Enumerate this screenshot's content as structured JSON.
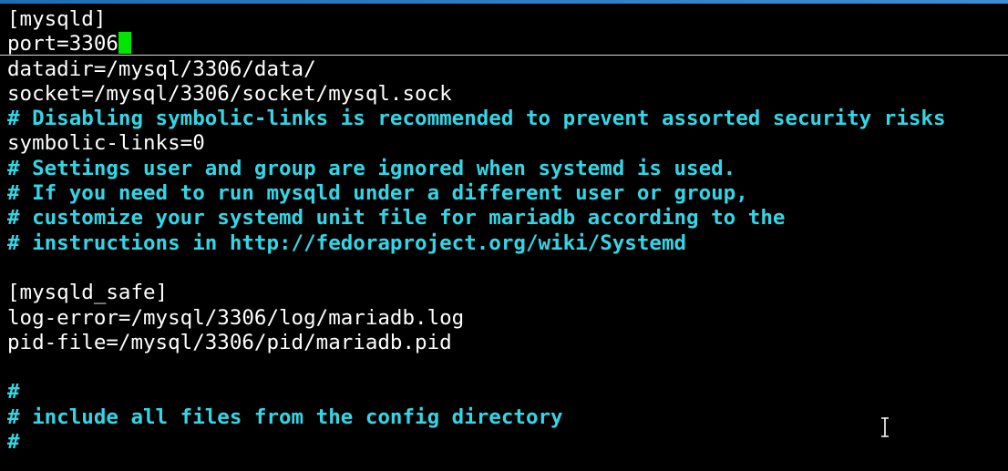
{
  "terminal": {
    "lines": [
      {
        "text": "[mysqld]",
        "kind": "plain"
      },
      {
        "text": "port=3306",
        "kind": "plain"
      },
      {
        "text": "datadir=/mysql/3306/data/",
        "kind": "plain"
      },
      {
        "text": "socket=/mysql/3306/socket/mysql.sock",
        "kind": "plain"
      },
      {
        "text": "# Disabling symbolic-links is recommended to prevent assorted security risks",
        "kind": "comment"
      },
      {
        "text": "symbolic-links=0",
        "kind": "plain"
      },
      {
        "text": "# Settings user and group are ignored when systemd is used.",
        "kind": "comment"
      },
      {
        "text": "# If you need to run mysqld under a different user or group,",
        "kind": "comment"
      },
      {
        "text": "# customize your systemd unit file for mariadb according to the",
        "kind": "comment"
      },
      {
        "text": "# instructions in http://fedoraproject.org/wiki/Systemd",
        "kind": "comment"
      },
      {
        "text": "",
        "kind": "plain"
      },
      {
        "text": "[mysqld_safe]",
        "kind": "plain"
      },
      {
        "text": "log-error=/mysql/3306/log/mariadb.log",
        "kind": "plain"
      },
      {
        "text": "pid-file=/mysql/3306/pid/mariadb.pid",
        "kind": "plain"
      },
      {
        "text": "",
        "kind": "plain"
      },
      {
        "text": "#",
        "kind": "comment"
      },
      {
        "text": "# include all files from the config directory",
        "kind": "comment"
      },
      {
        "text": "#",
        "kind": "comment"
      }
    ]
  },
  "colors": {
    "background": "#000000",
    "text": "#ffffff",
    "comment": "#33d6e6",
    "cursor": "#00e600",
    "title_bar": "#2a7fc8"
  },
  "icons": {
    "mouse_pointer": "text-ibeam-cursor-icon"
  }
}
